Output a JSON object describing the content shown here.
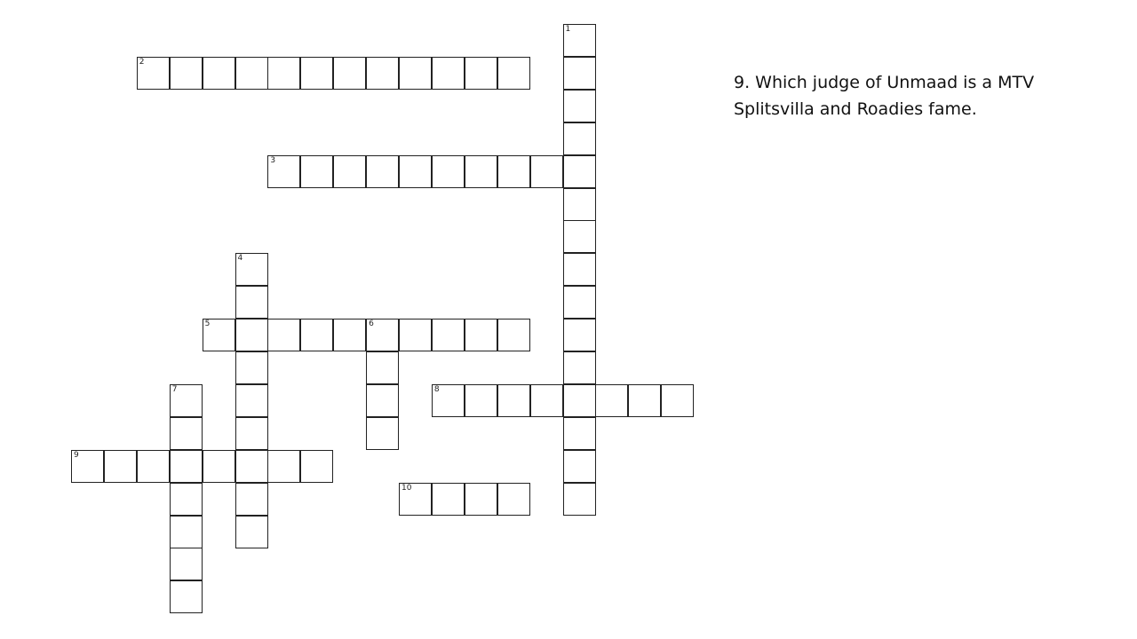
{
  "crossword": {
    "words": [
      {
        "number": "1",
        "direction": "down",
        "start": [
          15,
          0
        ],
        "length": 15
      },
      {
        "number": "2",
        "direction": "across",
        "start": [
          2,
          1
        ],
        "length": 12
      },
      {
        "number": "3",
        "direction": "across",
        "start": [
          6,
          4
        ],
        "length": 9
      },
      {
        "number": "4",
        "direction": "down",
        "start": [
          5,
          7
        ],
        "length": 9
      },
      {
        "number": "5",
        "direction": "across",
        "start": [
          4,
          9
        ],
        "length": 10
      },
      {
        "number": "6",
        "direction": "down",
        "start": [
          9,
          9
        ],
        "length": 4
      },
      {
        "number": "7",
        "direction": "down",
        "start": [
          3,
          11
        ],
        "length": 7
      },
      {
        "number": "8",
        "direction": "across",
        "start": [
          11,
          11
        ],
        "length": 8
      },
      {
        "number": "9",
        "direction": "across",
        "start": [
          0,
          13
        ],
        "length": 8
      },
      {
        "number": "10",
        "direction": "across",
        "start": [
          10,
          14
        ],
        "length": 4
      }
    ]
  },
  "clue": {
    "text": "9. Which judge of Unmaad is a MTV Splitsvilla and Roadies fame."
  }
}
